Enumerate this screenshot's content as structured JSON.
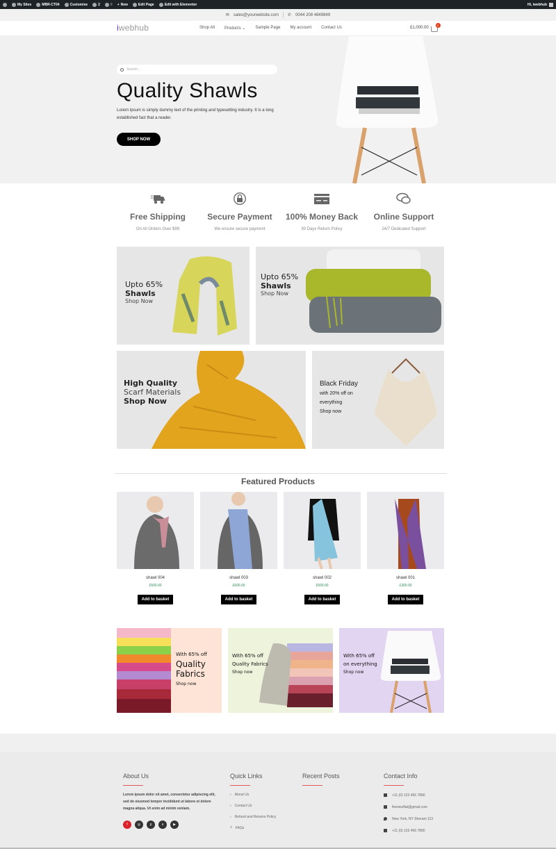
{
  "admin_bar": {
    "items": [
      {
        "icon": "wordpress-icon",
        "label": ""
      },
      {
        "icon": "my-sites-icon",
        "label": "My Sites"
      },
      {
        "icon": "site-icon",
        "label": "MBR-CT04"
      },
      {
        "icon": "brush-icon",
        "label": "Customise"
      },
      {
        "icon": "updates-icon",
        "label": "2"
      },
      {
        "icon": "comment-icon",
        "label": "0"
      },
      {
        "icon": "plus-icon",
        "label": "New"
      },
      {
        "icon": "pencil-icon",
        "label": "Edit Page"
      },
      {
        "icon": "elementor-icon",
        "label": "Edit with Elementor"
      }
    ],
    "greeting": "Hi, iwebhub"
  },
  "topbar": {
    "email": "sales@yourwebsite.com",
    "phone": "0044 208 4849849"
  },
  "header": {
    "logo_prefix": "i",
    "logo_rest": "webhub",
    "nav": [
      "Shop All",
      "Products",
      "Sample Page",
      "My account",
      "Contact Us"
    ],
    "cart_total": "£1,000.00",
    "cart_count": "2"
  },
  "hero": {
    "search_placeholder": "Search...",
    "title": "Quality Shawls",
    "text": "Lorem Ipsum is simply dummy text of the printing and typesetting industry. It is a long established fact that a reader.",
    "button": "SHOP NOW"
  },
  "features": [
    {
      "icon": "truck-icon",
      "title": "Free Shipping",
      "sub": "On All Orders Over $99"
    },
    {
      "icon": "lock-icon",
      "title": "Secure Payment",
      "sub": "We ensure secure payment"
    },
    {
      "icon": "credit-card-icon",
      "title": "100% Money Back",
      "sub": "30 Days Return Policy"
    },
    {
      "icon": "chat-icon",
      "title": "Online Support",
      "sub": "24/7 Dedicated Support"
    }
  ],
  "banners": [
    {
      "l1": "Upto 65%",
      "l2": "Shawls",
      "l3": "Shop Now"
    },
    {
      "l1": "Upto 65%",
      "l2": "Shawls",
      "l3": "Shop Now"
    },
    {
      "l1": "High Quality",
      "l2": "Scarf Materials",
      "l3": "Shop Now"
    },
    {
      "l1": "Black Friday",
      "l2": "with 20% off on",
      "l3": "everything",
      "l4": "Shop now"
    }
  ],
  "featured": {
    "title": "Featured Products",
    "products": [
      {
        "name": "shawl 004",
        "price": "£500.00",
        "button": "Add to basket",
        "color": "#c98e98"
      },
      {
        "name": "shawl 003",
        "price": "£600.00",
        "button": "Add to basket",
        "color": "#8ea6d6"
      },
      {
        "name": "shawl 002",
        "price": "£500.00",
        "button": "Add to basket",
        "color": "#86c3dc"
      },
      {
        "name": "shawl 001",
        "price": "£300.00",
        "button": "Add to basket",
        "color": "#7a4f9e"
      }
    ]
  },
  "promos": [
    {
      "l1": "With 65% off",
      "l2": "Quality",
      "l3": "Fabrics",
      "l4": "Shop now",
      "bg": "#fde4d6"
    },
    {
      "l1": "With 65% off",
      "l2": "Quality Fabrics",
      "l3": "Shop now",
      "bg": "#eef4dc"
    },
    {
      "l1": "With 65% off",
      "l2": "on everything",
      "l3": "Shop now",
      "bg": "#e2d5f2"
    }
  ],
  "footer": {
    "about": {
      "title": "About Us",
      "text": "Lorem ipsum dolor sit amet, consectetur adipiscing elit, sed do eiusmod tempor incididunt ut labore et dolore magna aliqua. Ut enim ad minim veniam.",
      "social": [
        "facebook-icon",
        "instagram-icon",
        "pinterest-icon",
        "skype-icon",
        "youtube-icon"
      ]
    },
    "quick_links": {
      "title": "Quick Links",
      "items": [
        "About Us",
        "Contact Us",
        "Refund and Returns Policy",
        "FAQs"
      ]
    },
    "recent_posts": {
      "title": "Recent Posts"
    },
    "contact": {
      "title": "Contact Info",
      "items": [
        "+11 (0) 123 456 7890",
        "themesflat@gmail.com",
        "New York, NY Sheram 113",
        "+11 (0) 123 456 7890"
      ]
    }
  }
}
